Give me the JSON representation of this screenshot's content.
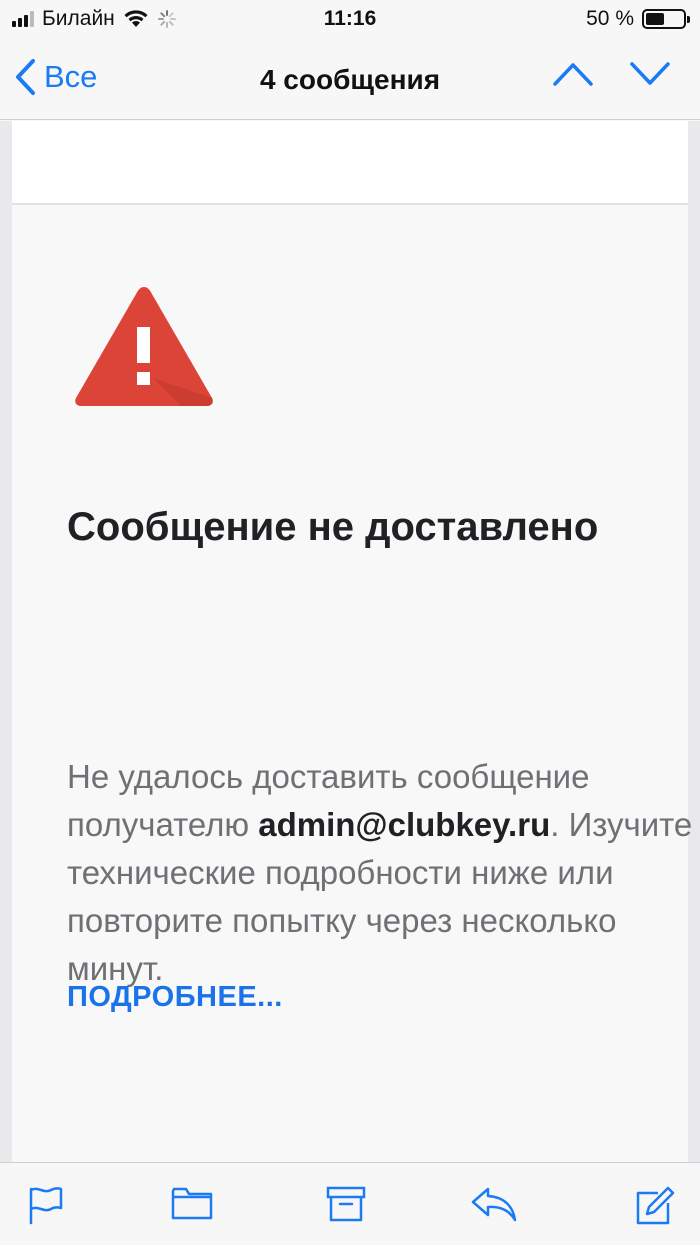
{
  "status_bar": {
    "carrier": "Билайн",
    "time": "11:16",
    "battery_text": "50 %",
    "battery_level": 0.5
  },
  "nav": {
    "back_label": "Все",
    "title": "4 сообщения"
  },
  "message": {
    "title": "Сообщение не доставлено",
    "body_before": "Не удалось доставить сообщение получателю ",
    "recipient": "admin@clubkey.ru",
    "body_after": ". Изучите технические подробности ниже или повторите попытку через несколько минут.",
    "more_link": "ПОДРОБНЕЕ..."
  },
  "colors": {
    "accent": "#1a7bf5",
    "link": "#1a73e8",
    "warning": "#db4437"
  },
  "toolbar": {
    "icons": [
      "flag-icon",
      "folder-icon",
      "archive-icon",
      "reply-icon",
      "compose-icon"
    ]
  }
}
